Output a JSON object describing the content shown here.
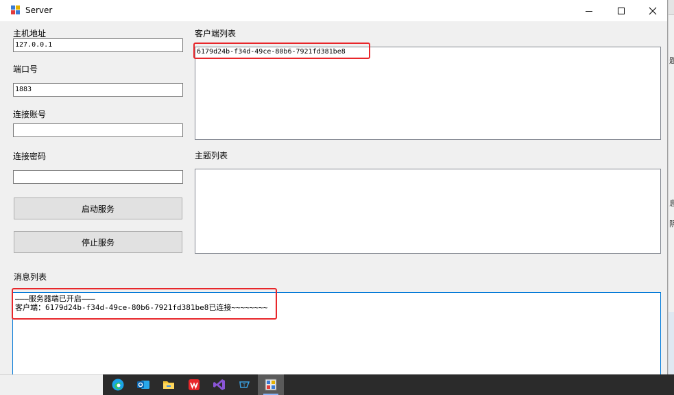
{
  "window": {
    "title": "Server"
  },
  "form": {
    "host_label": "主机地址",
    "host_value": "127.0.0.1",
    "port_label": "端口号",
    "port_value": "1883",
    "account_label": "连接账号",
    "account_value": "",
    "password_label": "连接密码",
    "password_value": "",
    "start_button": "启动服务",
    "stop_button": "停止服务"
  },
  "client_list": {
    "label": "客户端列表",
    "items": [
      "6179d24b-f34d-49ce-80b6-7921fd381be8"
    ]
  },
  "topic_list": {
    "label": "主题列表",
    "items": []
  },
  "message_list": {
    "label": "消息列表",
    "lines": [
      "———服务器端已开启———",
      "客户端：6179d24b-f34d-49ce-80b6-7921fd381be8已连接~~~~~~~~"
    ]
  },
  "desktop_edge": {
    "glyphs": [
      "题",
      "息",
      "阴"
    ]
  },
  "taskbar": {
    "apps": [
      "edge-icon",
      "outlook-icon",
      "file-explorer-icon",
      "wps-icon",
      "visual-studio-icon",
      "typora-icon",
      "server-app-icon"
    ],
    "active_index": 6
  },
  "colors": {
    "highlight": "#e8262a",
    "focus_border": "#0078d7",
    "window_bg": "#f0f0f0",
    "taskbar_bg": "#2b2b2b"
  }
}
